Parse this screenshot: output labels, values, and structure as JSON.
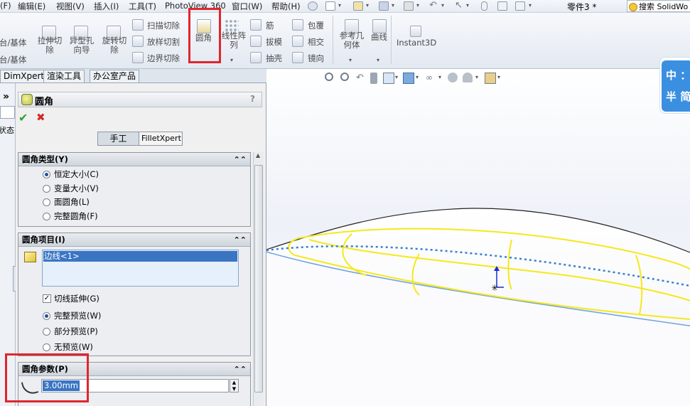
{
  "menubar": {
    "items": [
      "(F)",
      "编辑(E)",
      "视图(V)",
      "插入(I)",
      "工具(T)",
      "PhotoView 360",
      "窗口(W)",
      "帮助(H)"
    ],
    "document_title": "零件3 *",
    "search_placeholder": "搜索 SolidWo"
  },
  "ribbon": {
    "left_cut": [
      "台/基体",
      "台/基体"
    ],
    "extrude_cut": "拉伸切\n除",
    "hole_wizard": "异型孔\n向导",
    "revolve_cut": "旋转切\n除",
    "swept_cut": "扫描切除",
    "lofted_cut": "放样切割",
    "boundary_cut": "边界切除",
    "fillet": "圆角",
    "linear_pattern": "线性阵\n列",
    "rib": "筋",
    "draft": "拔模",
    "shell": "抽壳",
    "wrap": "包覆",
    "intersect": "相交",
    "mirror": "镜向",
    "ref_geometry": "参考几\n何体",
    "curves": "曲线",
    "instant3d": "Instant3D"
  },
  "tabs": [
    "DimXpert",
    "渲染工具",
    "办公室产品"
  ],
  "leftstrip": {
    "expand": "»",
    "state_label": "状态"
  },
  "pm": {
    "title": "圆角",
    "help": "?",
    "ok": "✔",
    "cancel": "✖",
    "mode_manual": "手工",
    "mode_filletxpert": "FilletXpert",
    "type_group": {
      "title": "圆角类型(Y)",
      "options": [
        "恒定大小(C)",
        "变量大小(V)",
        "面圆角(L)",
        "完整圆角(F)"
      ],
      "selected": 0
    },
    "items_group": {
      "title": "圆角项目(I)",
      "selection": "边线<1>",
      "tangent_propagation": "切线延伸(G)",
      "preview_options": [
        "完整预览(W)",
        "部分预览(P)",
        "无预览(W)"
      ],
      "preview_selected": 0
    },
    "params_group": {
      "title": "圆角参数(P)",
      "radius": "3.00mm"
    }
  },
  "side_widget": {
    "line1": "中 ：",
    "line2": "半 简"
  },
  "colors": {
    "highlight": "#e0262e",
    "accent": "#3a8fe0",
    "preview": "#f5e81c"
  }
}
